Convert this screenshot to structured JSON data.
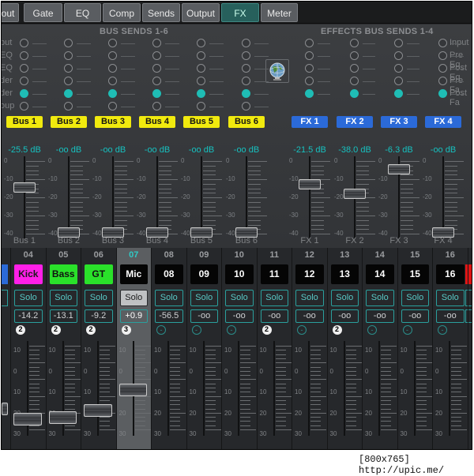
{
  "tabs": [
    {
      "label": "out",
      "active": false
    },
    {
      "label": "Gate",
      "active": false
    },
    {
      "label": "EQ",
      "active": false
    },
    {
      "label": "Comp",
      "active": false
    },
    {
      "label": "Sends",
      "active": false
    },
    {
      "label": "Output",
      "active": false
    },
    {
      "label": "FX",
      "active": true
    },
    {
      "label": "Meter",
      "active": false
    }
  ],
  "bus_sends": {
    "header": "BUS SENDS 1-6",
    "row_labels": [
      "put",
      "EQ",
      "EQ",
      "der",
      "der",
      "oup"
    ],
    "selected_row": 4,
    "buses": [
      {
        "label": "Bus 1",
        "db": "-25.5 dB",
        "name": "Bus 1",
        "level": 0.62
      },
      {
        "label": "Bus 2",
        "db": "-oo dB",
        "name": "Bus 2",
        "level": 0.0
      },
      {
        "label": "Bus 3",
        "db": "-oo dB",
        "name": "Bus 3",
        "level": 0.0
      },
      {
        "label": "Bus 4",
        "db": "-oo dB",
        "name": "Bus 4",
        "level": 0.0
      },
      {
        "label": "Bus 5",
        "db": "-oo dB",
        "name": "Bus 5",
        "level": 0.0
      },
      {
        "label": "Bus 6",
        "db": "-oo dB",
        "name": "Bus 6",
        "level": 0.0
      }
    ]
  },
  "fx_sends": {
    "header": "EFFECTS BUS SENDS 1-4",
    "row_labels": [
      "Input",
      "Pre Eq",
      "Post Eq",
      "Pre Fa",
      "Post Fa"
    ],
    "selected_row": 4,
    "buses": [
      {
        "label": "FX 1",
        "db": "-21.5 dB",
        "name": "FX 1",
        "level": 0.66
      },
      {
        "label": "FX 2",
        "db": "-38.0 dB",
        "name": "FX 2",
        "level": 0.53
      },
      {
        "label": "FX 3",
        "db": "-6.3 dB",
        "name": "FX 3",
        "level": 0.87
      },
      {
        "label": "FX 4",
        "db": "-oo dB",
        "name": "FX 4",
        "level": 0.0
      }
    ]
  },
  "send_scale": [
    "0",
    "-10",
    "-20",
    "-30",
    "-40"
  ],
  "channel_scale": [
    "10",
    "0",
    "10",
    "20",
    "30"
  ],
  "solo_label": "Solo",
  "channels": [
    {
      "num": "04",
      "name": "Kick",
      "color": "#ff1fe8",
      "text_color": "#1a1a1a",
      "db": "-14.2",
      "group": "2",
      "level": 0.17
    },
    {
      "num": "05",
      "name": "Bass",
      "color": "#2ae12a",
      "text_color": "#111111",
      "db": "-13.1",
      "group": "2",
      "level": 0.19
    },
    {
      "num": "06",
      "name": "GT",
      "color": "#2ae12a",
      "text_color": "#111111",
      "db": "-9.2",
      "group": "2",
      "level": 0.27
    },
    {
      "num": "07",
      "name": "Mic",
      "color": "#050505",
      "text_color": "#ffffff",
      "db": "+0.9",
      "group": "3",
      "level": 0.52,
      "selected": true
    },
    {
      "num": "08",
      "name": "08",
      "color": "#050505",
      "text_color": "#ffffff",
      "db": "-56.5",
      "group": "-",
      "level": 0.0
    },
    {
      "num": "09",
      "name": "09",
      "color": "#050505",
      "text_color": "#ffffff",
      "db": "-oo",
      "group": "-",
      "level": 0.0
    },
    {
      "num": "10",
      "name": "10",
      "color": "#050505",
      "text_color": "#ffffff",
      "db": "-oo",
      "group": "-",
      "level": 0.0
    },
    {
      "num": "11",
      "name": "11",
      "color": "#050505",
      "text_color": "#ffffff",
      "db": "-oo",
      "group": "2",
      "level": 0.0
    },
    {
      "num": "12",
      "name": "12",
      "color": "#050505",
      "text_color": "#ffffff",
      "db": "-oo",
      "group": "-",
      "level": 0.0
    },
    {
      "num": "13",
      "name": "13",
      "color": "#050505",
      "text_color": "#ffffff",
      "db": "-oo",
      "group": "2",
      "level": 0.0
    },
    {
      "num": "14",
      "name": "14",
      "color": "#050505",
      "text_color": "#ffffff",
      "db": "-oo",
      "group": "-",
      "level": 0.0
    },
    {
      "num": "15",
      "name": "15",
      "color": "#050505",
      "text_color": "#ffffff",
      "db": "-oo",
      "group": "-",
      "level": 0.0
    },
    {
      "num": "16",
      "name": "16",
      "color": "#050505",
      "text_color": "#ffffff",
      "db": "-oo",
      "group": "-",
      "level": 0.0
    }
  ],
  "watermark": "[800x765] http://upic.me/"
}
